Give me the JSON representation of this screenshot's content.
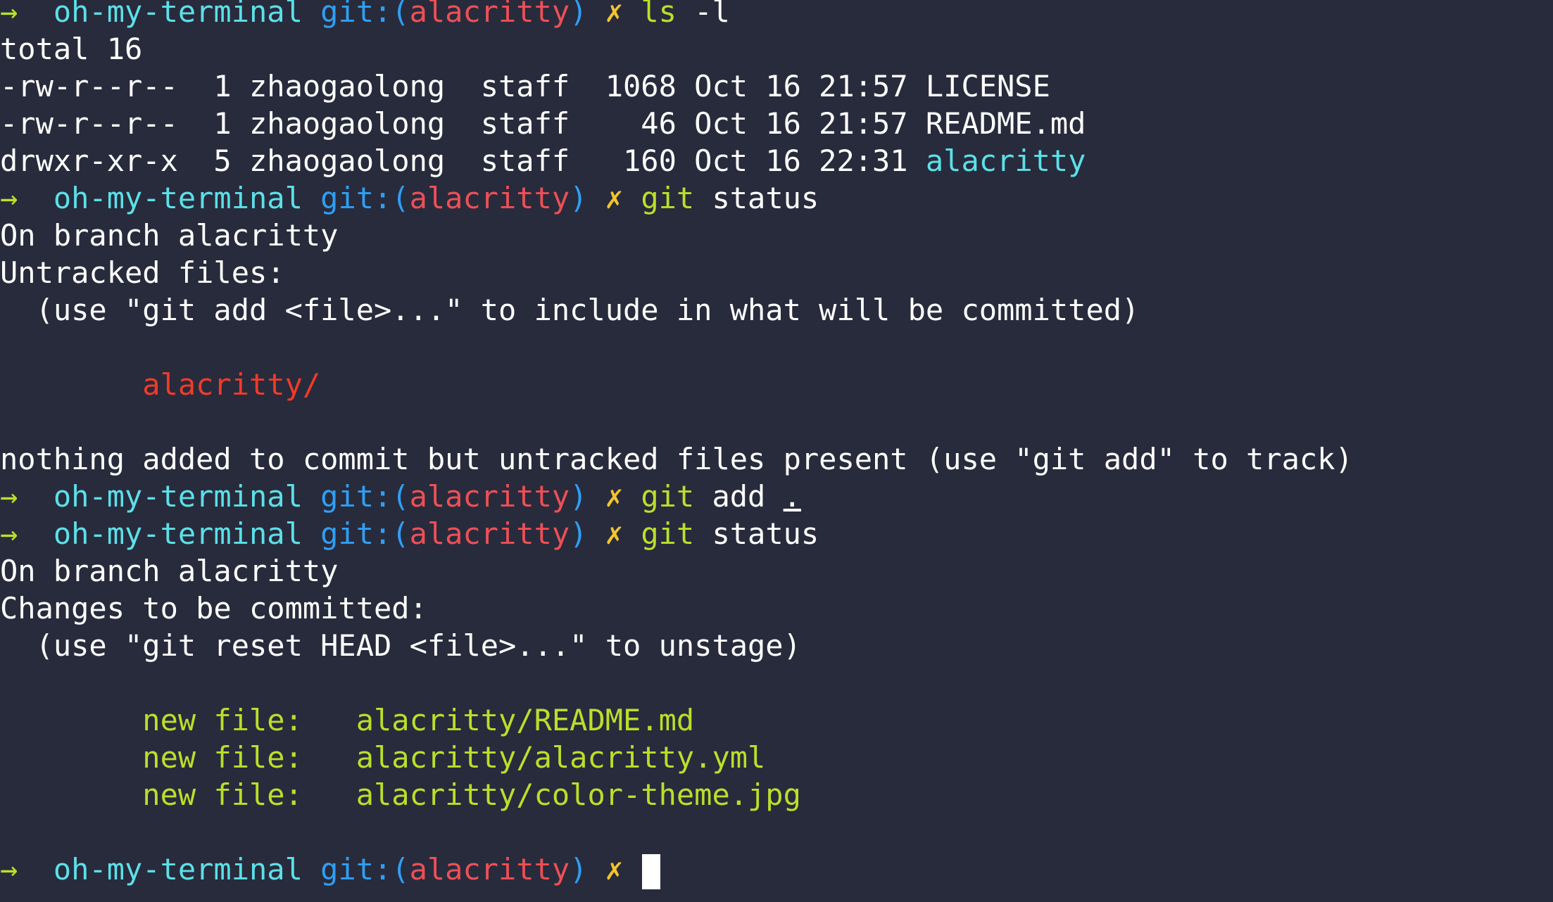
{
  "colors": {
    "background": "#282b3c",
    "foreground": "#ffffff",
    "arrow": "#b8e02a",
    "directory": "#5ce0e8",
    "git_label": "#2f9ff4",
    "branch": "#ee4f56",
    "dirty_mark": "#f4c52b",
    "command": "#b8e02a",
    "untracked": "#f23a2a",
    "staged": "#b8e02a",
    "dir_entry": "#5ce0e8"
  },
  "lines": [
    [
      [
        "→  ",
        "arrow"
      ],
      [
        "oh-my-terminal ",
        "directory"
      ],
      [
        "git:(",
        "git_label"
      ],
      [
        "alacritty",
        "branch"
      ],
      [
        ")",
        "git_label"
      ],
      [
        " ✗ ",
        "dirty_mark"
      ],
      [
        "ls",
        "command"
      ],
      [
        " -l",
        "foreground"
      ]
    ],
    [
      [
        "total 16",
        "foreground"
      ]
    ],
    [
      [
        "-rw-r--r--  1 zhaogaolong  staff  1068 Oct 16 21:57 LICENSE",
        "foreground"
      ]
    ],
    [
      [
        "-rw-r--r--  1 zhaogaolong  staff    46 Oct 16 21:57 README.md",
        "foreground"
      ]
    ],
    [
      [
        "drwxr-xr-x  5 zhaogaolong  staff   160 Oct 16 22:31 ",
        "foreground"
      ],
      [
        "alacritty",
        "dir_entry"
      ]
    ],
    [
      [
        "→  ",
        "arrow"
      ],
      [
        "oh-my-terminal ",
        "directory"
      ],
      [
        "git:(",
        "git_label"
      ],
      [
        "alacritty",
        "branch"
      ],
      [
        ")",
        "git_label"
      ],
      [
        " ✗ ",
        "dirty_mark"
      ],
      [
        "git",
        "command"
      ],
      [
        " status",
        "foreground"
      ]
    ],
    [
      [
        "On branch alacritty",
        "foreground"
      ]
    ],
    [
      [
        "Untracked files:",
        "foreground"
      ]
    ],
    [
      [
        "  (use \"git add <file>...\" to include in what will be committed)",
        "foreground"
      ]
    ],
    [
      [
        "",
        "foreground"
      ]
    ],
    [
      [
        "        ",
        "foreground"
      ],
      [
        "alacritty/",
        "untracked"
      ]
    ],
    [
      [
        "",
        "foreground"
      ]
    ],
    [
      [
        "nothing added to commit but untracked files present (use \"git add\" to track)",
        "foreground"
      ]
    ],
    [
      [
        "→  ",
        "arrow"
      ],
      [
        "oh-my-terminal ",
        "directory"
      ],
      [
        "git:(",
        "git_label"
      ],
      [
        "alacritty",
        "branch"
      ],
      [
        ")",
        "git_label"
      ],
      [
        " ✗ ",
        "dirty_mark"
      ],
      [
        "git",
        "command"
      ],
      [
        " add ",
        "foreground"
      ],
      [
        ".",
        "foreground",
        "underline"
      ]
    ],
    [
      [
        "→  ",
        "arrow"
      ],
      [
        "oh-my-terminal ",
        "directory"
      ],
      [
        "git:(",
        "git_label"
      ],
      [
        "alacritty",
        "branch"
      ],
      [
        ")",
        "git_label"
      ],
      [
        " ✗ ",
        "dirty_mark"
      ],
      [
        "git",
        "command"
      ],
      [
        " status",
        "foreground"
      ]
    ],
    [
      [
        "On branch alacritty",
        "foreground"
      ]
    ],
    [
      [
        "Changes to be committed:",
        "foreground"
      ]
    ],
    [
      [
        "  (use \"git reset HEAD <file>...\" to unstage)",
        "foreground"
      ]
    ],
    [
      [
        "",
        "foreground"
      ]
    ],
    [
      [
        "        ",
        "foreground"
      ],
      [
        "new file:   alacritty/README.md",
        "staged"
      ]
    ],
    [
      [
        "        ",
        "foreground"
      ],
      [
        "new file:   alacritty/alacritty.yml",
        "staged"
      ]
    ],
    [
      [
        "        ",
        "foreground"
      ],
      [
        "new file:   alacritty/color-theme.jpg",
        "staged"
      ]
    ],
    [
      [
        "",
        "foreground"
      ]
    ],
    [
      [
        "→  ",
        "arrow"
      ],
      [
        "oh-my-terminal ",
        "directory"
      ],
      [
        "git:(",
        "git_label"
      ],
      [
        "alacritty",
        "branch"
      ],
      [
        ")",
        "git_label"
      ],
      [
        " ✗ ",
        "dirty_mark"
      ],
      [
        "",
        "cursor"
      ]
    ]
  ]
}
